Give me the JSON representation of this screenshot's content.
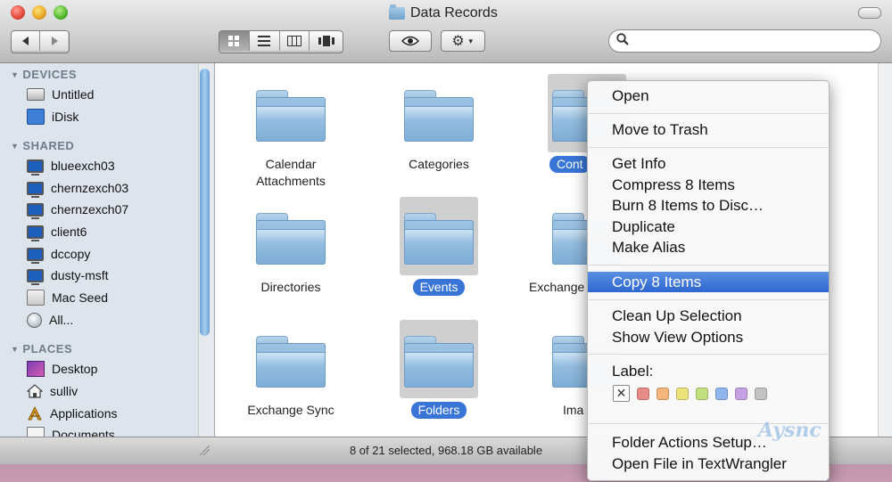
{
  "window": {
    "title": "Data Records"
  },
  "toolbar": {
    "back_icon": "left-arrow",
    "forward_icon": "right-arrow",
    "views": [
      "icon-view",
      "list-view",
      "column-view",
      "coverflow-view"
    ],
    "quicklook_icon": "eye",
    "action_icon": "gear",
    "search_placeholder": ""
  },
  "sidebar": {
    "devices_header": "DEVICES",
    "devices": [
      {
        "label": "Untitled",
        "icon": "drive-icon"
      },
      {
        "label": "iDisk",
        "icon": "idisk-icon"
      }
    ],
    "shared_header": "SHARED",
    "shared": [
      {
        "label": "blueexch03",
        "icon": "monitor-icon"
      },
      {
        "label": "chernzexch03",
        "icon": "monitor-icon"
      },
      {
        "label": "chernzexch07",
        "icon": "monitor-icon"
      },
      {
        "label": "client6",
        "icon": "monitor-icon"
      },
      {
        "label": "dccopy",
        "icon": "monitor-icon"
      },
      {
        "label": "dusty-msft",
        "icon": "monitor-icon"
      },
      {
        "label": "Mac Seed",
        "icon": "mac-icon"
      },
      {
        "label": "All...",
        "icon": "globe-icon"
      }
    ],
    "places_header": "PLACES",
    "places": [
      {
        "label": "Desktop",
        "icon": "desktop-icon"
      },
      {
        "label": "sulliv",
        "icon": "home-icon"
      },
      {
        "label": "Applications",
        "icon": "applications-icon"
      },
      {
        "label": "Documents",
        "icon": "documents-icon"
      }
    ]
  },
  "folders": [
    {
      "name": "Calendar\nAttachments",
      "line1": "Calendar",
      "line2": "Attachments",
      "selected": false
    },
    {
      "name": "Categories",
      "line1": "Categories",
      "line2": "",
      "selected": false
    },
    {
      "name": "Cont",
      "line1": "Cont",
      "line2": "",
      "selected": true
    },
    {
      "name": "Directories",
      "line1": "Directories",
      "line2": "",
      "selected": false
    },
    {
      "name": "Events",
      "line1": "Events",
      "line2": "",
      "selected": true
    },
    {
      "name": "Exchange",
      "line1": "Exchange",
      "line2": "",
      "selected": false
    },
    {
      "name": "Exchange Sync",
      "line1": "Exchange Sync",
      "line2": "",
      "selected": false
    },
    {
      "name": "Folders",
      "line1": "Folders",
      "line2": "",
      "selected": true
    },
    {
      "name": "Ima",
      "line1": "Ima",
      "line2": "",
      "selected": false
    }
  ],
  "status_bar": {
    "text": "8 of 21 selected, 968.18 GB available"
  },
  "context_menu": {
    "items": {
      "open": "Open",
      "move_to_trash": "Move to Trash",
      "get_info": "Get Info",
      "compress": "Compress 8 Items",
      "burn": "Burn 8 Items to Disc…",
      "duplicate": "Duplicate",
      "make_alias": "Make Alias",
      "copy": "Copy 8 Items",
      "clean_up": "Clean Up Selection",
      "show_view_options": "Show View Options",
      "label": "Label:",
      "folder_actions": "Folder Actions Setup…",
      "open_in_textwrangler": "Open File in TextWrangler"
    },
    "highlighted": "copy",
    "label_colors": [
      "#e88a86",
      "#f3b57a",
      "#ece27a",
      "#c3e07f",
      "#8fb5ef",
      "#c6a1e3",
      "#c2c2c2"
    ],
    "label_none_glyph": "✕"
  },
  "watermark": "Aysnc"
}
